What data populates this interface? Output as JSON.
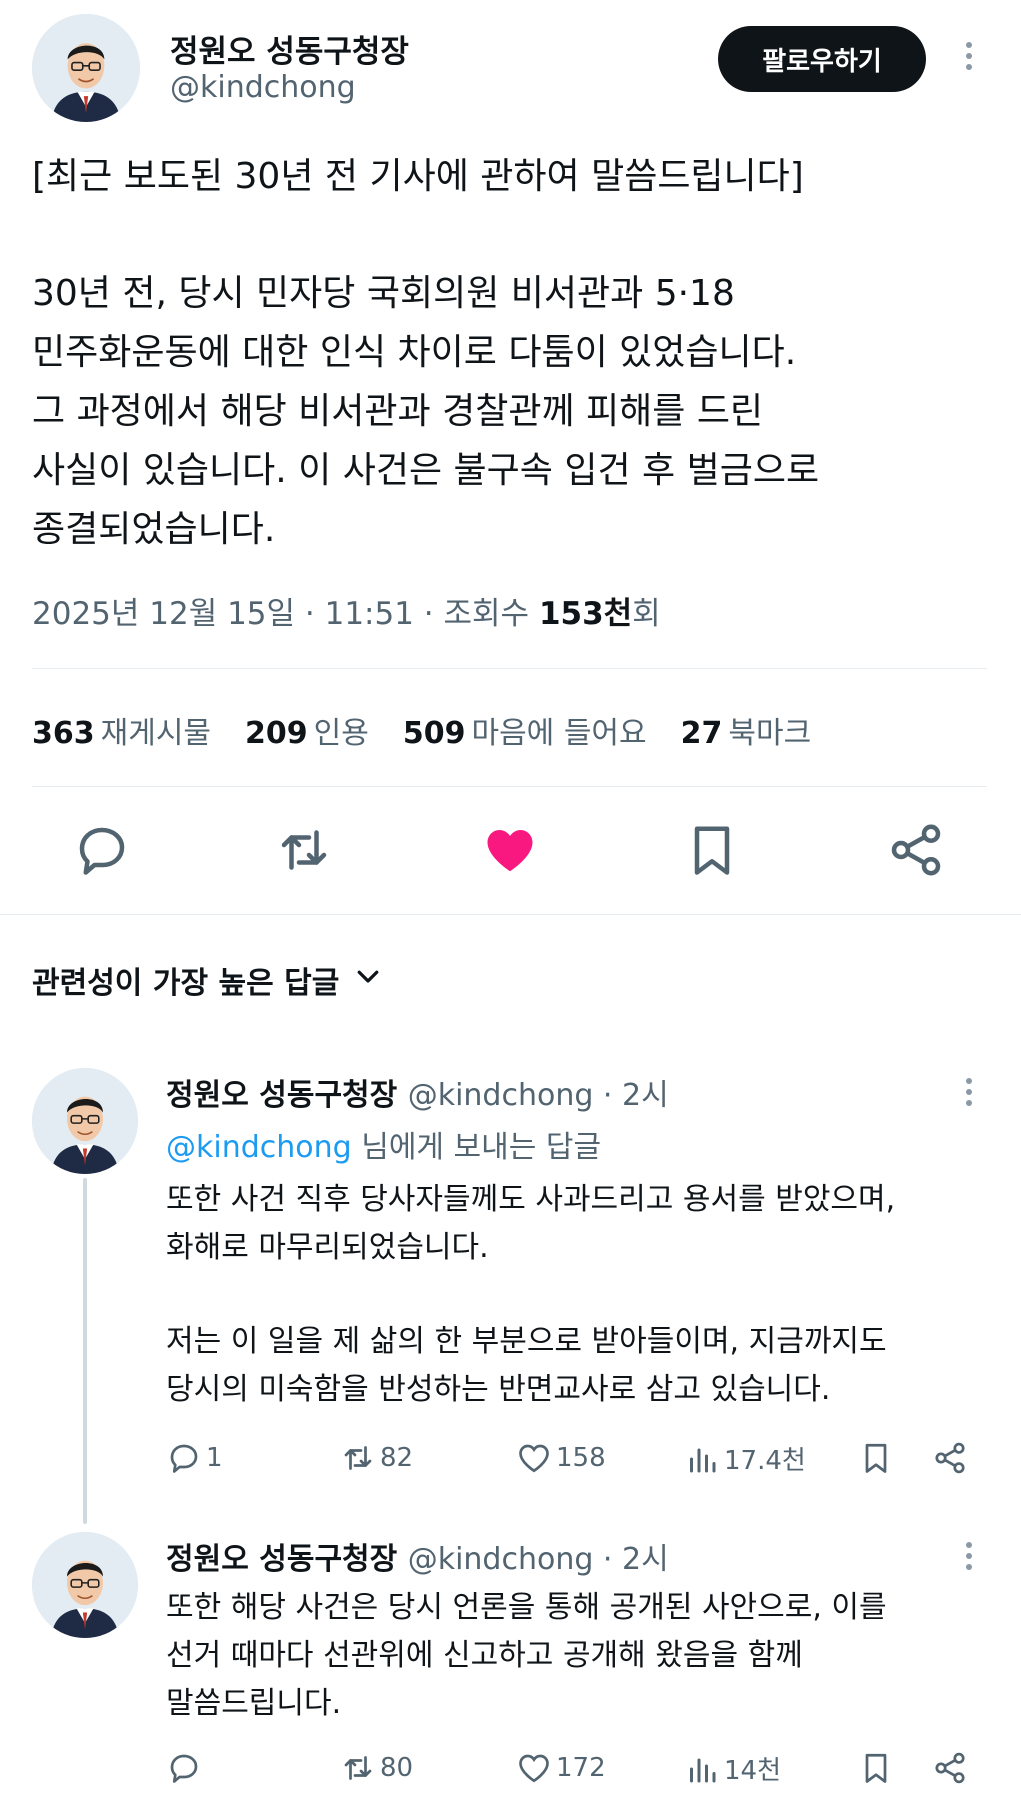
{
  "post": {
    "author_name": "정원오 성동구청장",
    "author_handle": "@kindchong",
    "follow_label": "팔로우하기",
    "text_lines": [
      "[최근 보도된 30년 전 기사에 관하여 말씀드립니다]",
      "",
      "30년 전, 당시 민자당 국회의원 비서관과 5·18",
      "민주화운동에 대한 인식 차이로 다툼이 있었습니다.",
      "그 과정에서 해당 비서관과 경찰관께 피해를 드린",
      "사실이 있습니다. 이 사건은 불구속 입건 후 벌금으로",
      "종결되었습니다."
    ],
    "timestamp": "2025년 12월 15일 · 11:51 · 조회수 ",
    "views_count": "153천",
    "views_suffix": "회",
    "stats": [
      {
        "num": "363",
        "label": "재게시물"
      },
      {
        "num": "209",
        "label": "인용"
      },
      {
        "num": "509",
        "label": "마음에 들어요"
      },
      {
        "num": "27",
        "label": "북마크"
      }
    ],
    "like_color": "#f91880"
  },
  "sort": {
    "label": "관련성이 가장 높은 답글"
  },
  "replies": [
    {
      "author_name": "정원오 성동구청장",
      "handle_time": "@kindchong · 2시",
      "reply_to_mention": "@kindchong",
      "reply_to_suffix": " 님에게 보내는 답글",
      "text_lines": [
        "또한 사건 직후 당사자들께도 사과드리고 용서를 받았으며,",
        "화해로 마무리되었습니다.",
        "",
        "저는 이 일을 제 삶의 한 부분으로 받아들이며, 지금까지도",
        "당시의 미숙함을 반성하는 반면교사로 삼고 있습니다."
      ],
      "replies": "1",
      "reposts": "82",
      "likes": "158",
      "views": "17.4천"
    },
    {
      "author_name": "정원오 성동구청장",
      "handle_time": "@kindchong · 2시",
      "text_lines": [
        "또한 해당 사건은 당시 언론을 통해 공개된 사안으로, 이를",
        "선거 때마다 선관위에 신고하고 공개해 왔음을 함께",
        "말씀드립니다."
      ],
      "replies": "",
      "reposts": "80",
      "likes": "172",
      "views": "14천"
    }
  ],
  "icons": {
    "reply": "speech-bubble-icon",
    "repost": "repost-arrows-icon",
    "like": "heart-icon",
    "bookmark": "bookmark-icon",
    "share": "share-nodes-icon",
    "views": "bar-chart-icon",
    "more": "vertical-dots-icon",
    "sort_toggle": "chevron-down-icon"
  },
  "colors": {
    "text": "#0f1419",
    "secondary": "#536471",
    "mention": "#1d9bf0",
    "like_active": "#f91880"
  }
}
